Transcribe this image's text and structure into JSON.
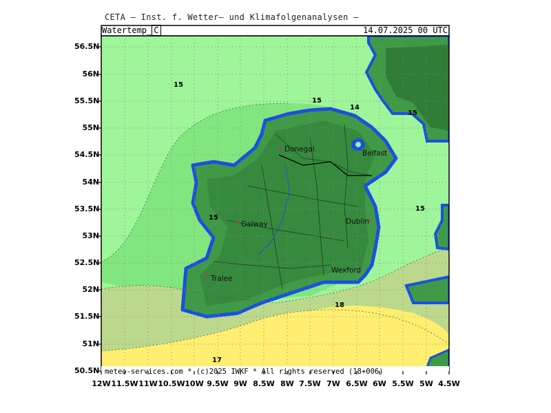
{
  "header": {
    "title": "CETA — Inst. f. Wetter— und Klimafolgenanalysen —",
    "parameter": "Watertemp",
    "unit": "C",
    "datetime": "14.07.2025 00 UTC"
  },
  "footer": {
    "text": "meteo-services.com * (c)2025 IWKF * All rights reserved (18+006)"
  },
  "axes": {
    "lat_ticks": [
      "56.5N",
      "56N",
      "55.5N",
      "55N",
      "54.5N",
      "54N",
      "53.5N",
      "53N",
      "52.5N",
      "52N",
      "51.5N",
      "51N",
      "50.5N"
    ],
    "lon_ticks": [
      "12W",
      "11.5W",
      "11W",
      "10.5W",
      "10W",
      "9.5W",
      "9W",
      "8.5W",
      "8W",
      "7.5W",
      "7W",
      "6.5W",
      "6W",
      "5.5W",
      "5W",
      "4.5W"
    ]
  },
  "contour_labels": [
    {
      "id": "c15-nw",
      "text": "15"
    },
    {
      "id": "c15-n",
      "text": "15"
    },
    {
      "id": "c14-n",
      "text": "14"
    },
    {
      "id": "c15-ne",
      "text": "15"
    },
    {
      "id": "c15-e",
      "text": "15"
    },
    {
      "id": "c15-galway",
      "text": "15"
    },
    {
      "id": "c18-s",
      "text": "18"
    },
    {
      "id": "c17-sw",
      "text": "17"
    }
  ],
  "cities": [
    "Donegal",
    "Belfast",
    "Galway",
    "Dublin",
    "Wexford",
    "Tralee"
  ],
  "colors": {
    "sea_light_green": "#9ef59a",
    "sea_green": "#82e67e",
    "sea_olive": "#bcd88c",
    "sea_yellow": "#ffee70",
    "land_green": "#3f9a46",
    "land_dark_green": "#2f7d36",
    "coast_blue": "#1a50e0",
    "city_marker": "#e0207a"
  }
}
